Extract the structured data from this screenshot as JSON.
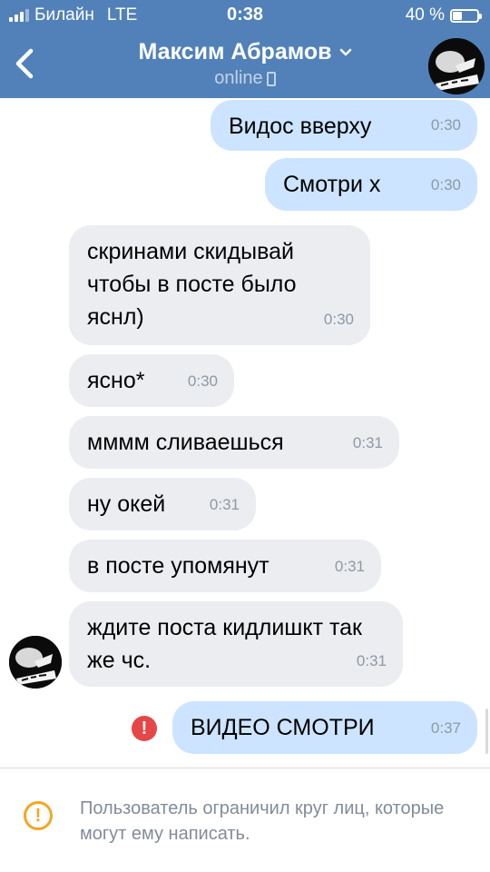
{
  "status_bar": {
    "carrier": "Билайн",
    "network": "LTE",
    "time": "0:38",
    "battery": "40 %",
    "battery_level": 0.4
  },
  "header": {
    "title": "Максим Абрамов",
    "status": "online"
  },
  "messages": [
    {
      "dir": "out",
      "text": "Видос вверху",
      "time": "0:30"
    },
    {
      "dir": "out",
      "text": "Смотри х",
      "time": "0:30"
    },
    {
      "dir": "in",
      "text": "скринами скидывай чтобы в посте было яснл)",
      "time": "0:30"
    },
    {
      "dir": "in",
      "text": "ясно*",
      "time": "0:30"
    },
    {
      "dir": "in",
      "text": "мммм сливаешься",
      "time": "0:31"
    },
    {
      "dir": "in",
      "text": "ну окей",
      "time": "0:31"
    },
    {
      "dir": "in",
      "text": "в посте упомянут",
      "time": "0:31"
    },
    {
      "dir": "in",
      "text": "ждите поста кидлишкт так же чс.",
      "time": "0:31"
    },
    {
      "dir": "out",
      "text": "ВИДЕО СМОТРИ",
      "time": "0:37",
      "failed": true
    }
  ],
  "notice": {
    "text": "Пользователь ограничил круг лиц, которые могут ему написать."
  },
  "colors": {
    "header": "#5181b8",
    "incoming_bubble": "#ebedf0",
    "outgoing_bubble": "#cce4ff",
    "error": "#e64646",
    "warning": "#f5a623"
  }
}
